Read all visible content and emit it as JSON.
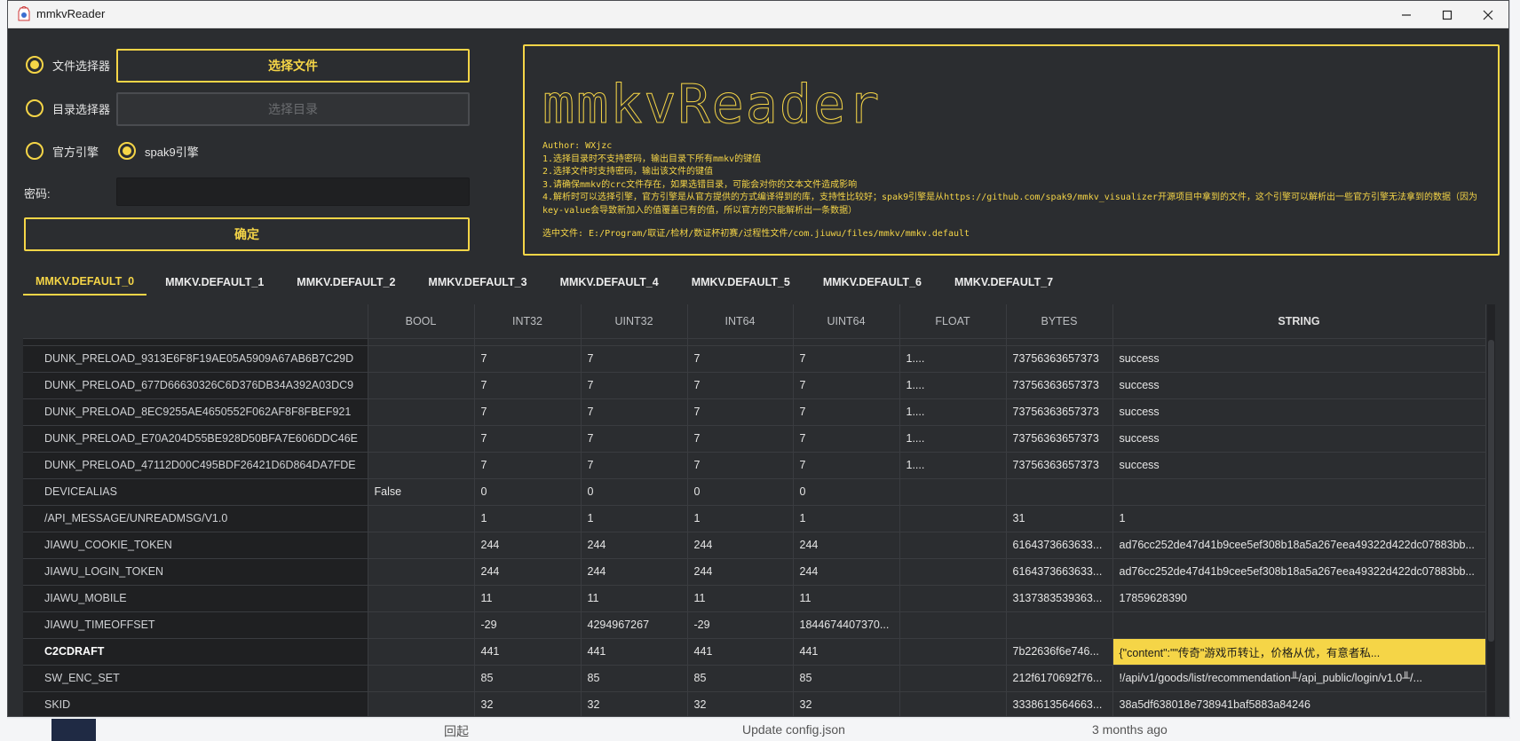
{
  "window": {
    "title": "mmkvReader"
  },
  "controls": {
    "file_selector_label": "文件选择器",
    "select_file_button": "选择文件",
    "dir_selector_label": "目录选择器",
    "select_dir_button": "选择目录",
    "engine_official_label": "官方引擎",
    "engine_spak9_label": "spak9引擎",
    "password_label": "密码:",
    "password_value": "",
    "confirm_button": "确定"
  },
  "info": {
    "ascii_logo": "mmkvReader",
    "author": "Author: WXjzc",
    "line1": "1.选择目录时不支持密码，输出目录下所有mmkv的键值",
    "line2": "2.选择文件时支持密码，输出该文件的键值",
    "line3": "3.请确保mmkv的crc文件存在，如果选错目录，可能会对你的文本文件造成影响",
    "line4": "4.解析时可以选择引擎，官方引擎是从官方提供的方式编译得到的库，支持性比较好；spak9引擎是从https://github.com/spak9/mmkv_visualizer开源项目中拿到的文件，这个引擎可以解析出一些官方引擎无法拿到的数据（因为key-value会导致新加入的值覆盖已有的值，所以官方的只能解析出一条数据）",
    "selected_file": "选中文件: E:/Program/取证/检材/数证杯初赛/过程性文件/com.jiuwu/files/mmkv/mmkv.default"
  },
  "tabs": [
    "MMKV.DEFAULT_0",
    "MMKV.DEFAULT_1",
    "MMKV.DEFAULT_2",
    "MMKV.DEFAULT_3",
    "MMKV.DEFAULT_4",
    "MMKV.DEFAULT_5",
    "MMKV.DEFAULT_6",
    "MMKV.DEFAULT_7"
  ],
  "table": {
    "columns": [
      "",
      "BOOL",
      "INT32",
      "UINT32",
      "INT64",
      "UINT64",
      "FLOAT",
      "BYTES",
      "STRING"
    ],
    "rows": [
      {
        "key": "DUNK_PRELOAD_9313E6F8F19AE05A5909A67AB6B7C29D",
        "bool": "",
        "int32": "7",
        "uint32": "7",
        "int64": "7",
        "uint64": "7",
        "float": "1....",
        "bytes": "73756363657373",
        "string": "success"
      },
      {
        "key": "DUNK_PRELOAD_677D66630326C6D376DB34A392A03DC9",
        "bool": "",
        "int32": "7",
        "uint32": "7",
        "int64": "7",
        "uint64": "7",
        "float": "1....",
        "bytes": "73756363657373",
        "string": "success"
      },
      {
        "key": "DUNK_PRELOAD_8EC9255AE4650552F062AF8F8FBEF921",
        "bool": "",
        "int32": "7",
        "uint32": "7",
        "int64": "7",
        "uint64": "7",
        "float": "1....",
        "bytes": "73756363657373",
        "string": "success"
      },
      {
        "key": "DUNK_PRELOAD_E70A204D55BE928D50BFA7E606DDC46E",
        "bool": "",
        "int32": "7",
        "uint32": "7",
        "int64": "7",
        "uint64": "7",
        "float": "1....",
        "bytes": "73756363657373",
        "string": "success"
      },
      {
        "key": "DUNK_PRELOAD_47112D00C495BDF26421D6D864DA7FDE",
        "bool": "",
        "int32": "7",
        "uint32": "7",
        "int64": "7",
        "uint64": "7",
        "float": "1....",
        "bytes": "73756363657373",
        "string": "success"
      },
      {
        "key": "DEVICEALIAS",
        "bool": "False",
        "int32": "0",
        "uint32": "0",
        "int64": "0",
        "uint64": "0",
        "float": "",
        "bytes": "",
        "string": ""
      },
      {
        "key": "/API_MESSAGE/UNREADMSG/V1.0",
        "bool": "",
        "int32": "1",
        "uint32": "1",
        "int64": "1",
        "uint64": "1",
        "float": "",
        "bytes": "31",
        "string": "1"
      },
      {
        "key": "JIAWU_COOKIE_TOKEN",
        "bool": "",
        "int32": "244",
        "uint32": "244",
        "int64": "244",
        "uint64": "244",
        "float": "",
        "bytes": "6164373663633...",
        "string": "ad76cc252de47d41b9cee5ef308b18a5a267eea49322d422dc07883bb..."
      },
      {
        "key": "JIAWU_LOGIN_TOKEN",
        "bool": "",
        "int32": "244",
        "uint32": "244",
        "int64": "244",
        "uint64": "244",
        "float": "",
        "bytes": "6164373663633...",
        "string": "ad76cc252de47d41b9cee5ef308b18a5a267eea49322d422dc07883bb..."
      },
      {
        "key": "JIAWU_MOBILE",
        "bool": "",
        "int32": "11",
        "uint32": "11",
        "int64": "11",
        "uint64": "11",
        "float": "",
        "bytes": "3137383539363...",
        "string": "17859628390"
      },
      {
        "key": "JIAWU_TIMEOFFSET",
        "bool": "",
        "int32": "-29",
        "uint32": "4294967267",
        "int64": "-29",
        "uint64": "1844674407370...",
        "float": "",
        "bytes": "",
        "string": ""
      },
      {
        "key": "C2CDRAFT",
        "bool": "",
        "int32": "441",
        "uint32": "441",
        "int64": "441",
        "uint64": "441",
        "float": "",
        "bytes": "7b22636f6e746...",
        "string": "{\"content\":\"\"传奇\"游戏币转让，价格从优，有意者私..."
      },
      {
        "key": "SW_ENC_SET",
        "bool": "",
        "int32": "85",
        "uint32": "85",
        "int64": "85",
        "uint64": "85",
        "float": "",
        "bytes": "212f6170692f76...",
        "string": "!/api/v1/goods/list/recommendation╨/api_public/login/v1.0╨/..."
      },
      {
        "key": "SKID",
        "bool": "",
        "int32": "32",
        "uint32": "32",
        "int64": "32",
        "uint64": "32",
        "float": "",
        "bytes": "3338613564663...",
        "string": "38a5df638018e738941baf5883a84246"
      }
    ]
  },
  "background": {
    "bottom_left_text": "回起",
    "bottom_mid_text": "Update config.json",
    "bottom_right_text": "3 months ago"
  },
  "colors": {
    "accent": "#f5d547",
    "window_bg": "#2b2d30",
    "rowhead_bg": "#1f2022"
  }
}
